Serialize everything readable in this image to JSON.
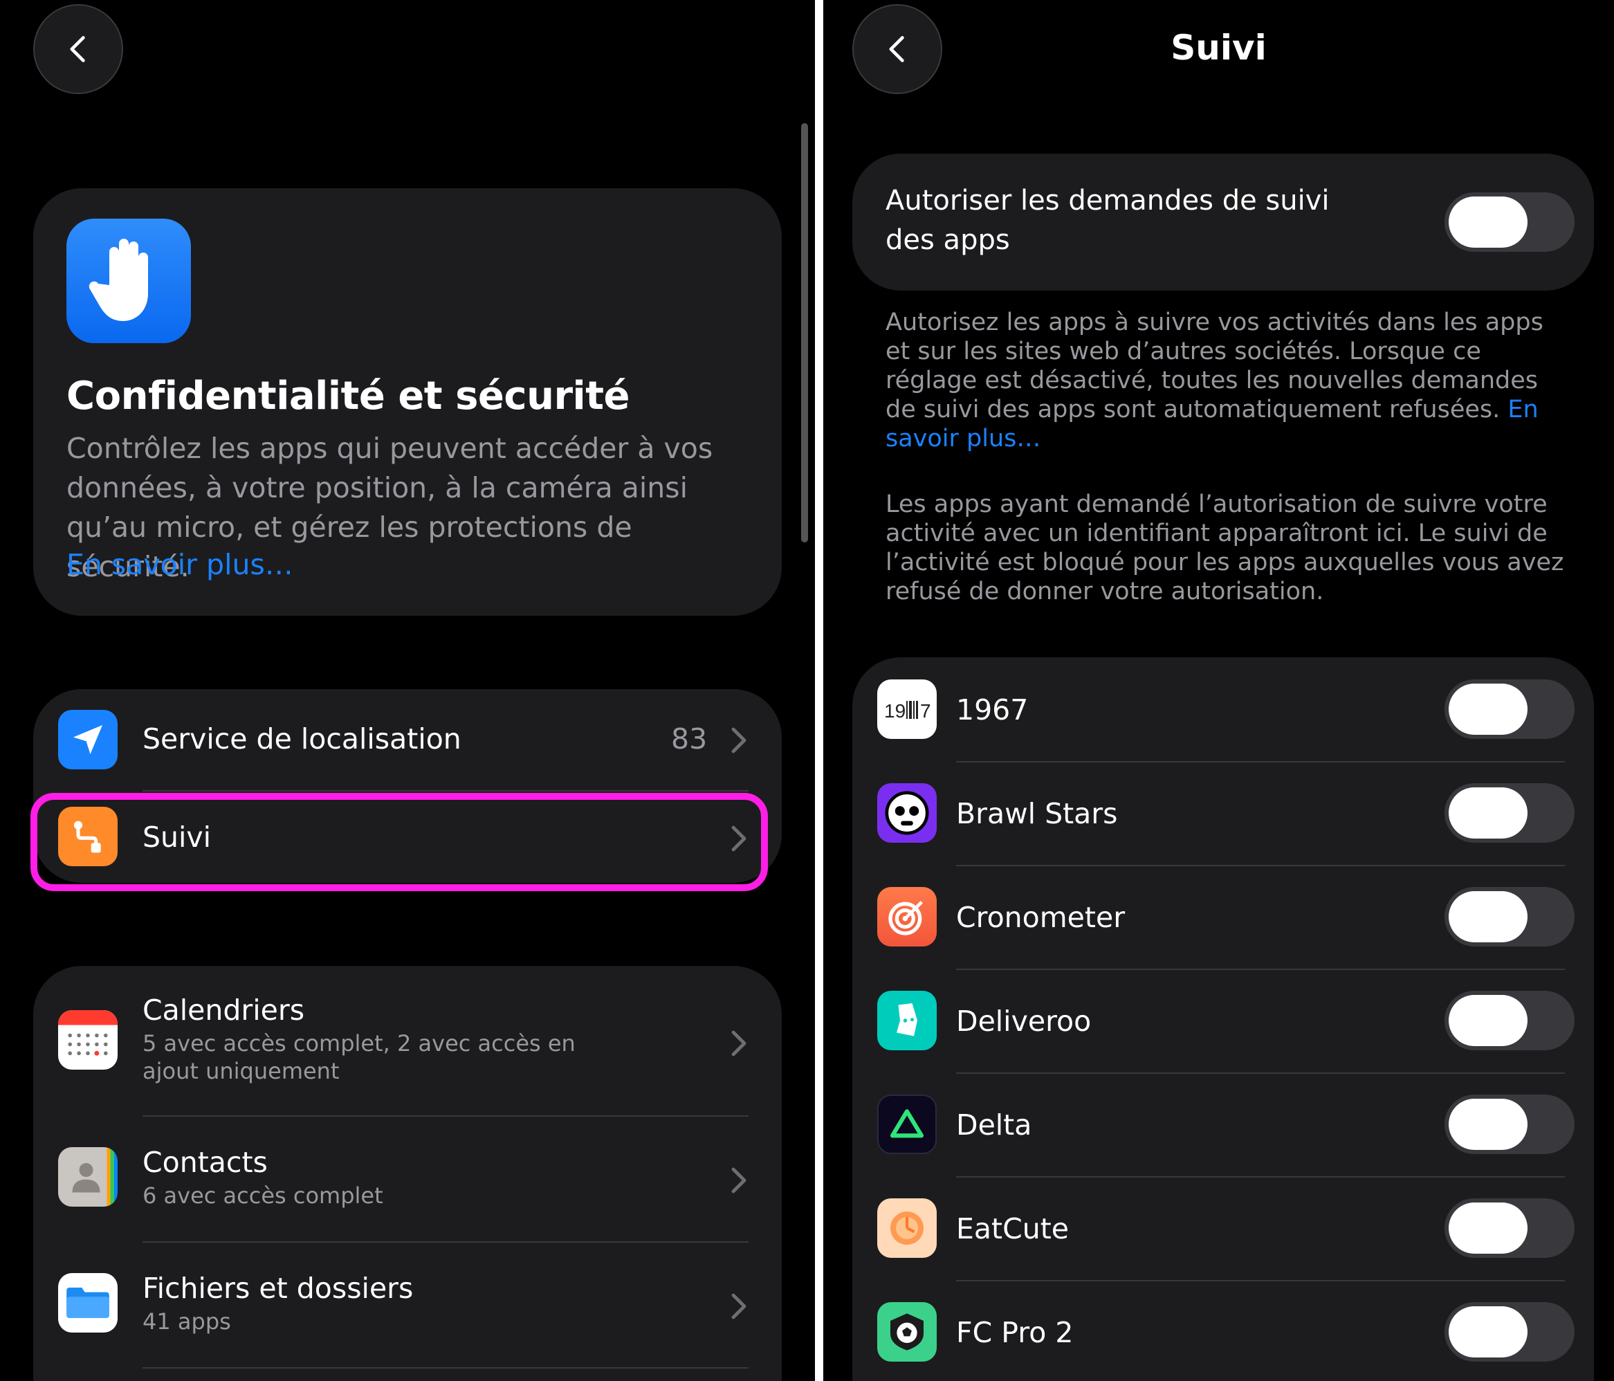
{
  "left": {
    "header": {
      "title": "Confidentialité et sécurité",
      "description": "Contrôlez les apps qui peuvent accéder à vos données, à votre position, à la caméra ainsi qu’au micro, et gérez les protections de sécurité.",
      "link": "En savoir plus…"
    },
    "group1": [
      {
        "title": "Service de localisation",
        "value": "83",
        "icon": "location-arrow-icon",
        "color": "#1a82ff"
      },
      {
        "title": "Suivi",
        "value": "",
        "icon": "tracking-icon",
        "color": "#ff8a2a"
      }
    ],
    "group2": [
      {
        "title": "Calendriers",
        "subtitle": "5 avec accès complet, 2 avec accès en ajout uniquement",
        "icon": "calendar-icon"
      },
      {
        "title": "Contacts",
        "subtitle": "6 avec accès complet",
        "icon": "contacts-icon"
      },
      {
        "title": "Fichiers et dossiers",
        "subtitle": "41 apps",
        "icon": "folder-icon"
      }
    ],
    "highlight_color": "#ff1ee6"
  },
  "right": {
    "nav_title": "Suivi",
    "allow": {
      "label": "Autoriser les demandes de suivi des apps",
      "on": false
    },
    "note1": "Autorisez les apps à suivre vos activités dans les apps et sur les sites web d’autres sociétés. Lorsque ce réglage est désactivé, toutes les nouvelles demandes de suivi des apps sont automatiquement refusées.",
    "note1_link": "En savoir plus…",
    "note2": "Les apps ayant demandé l’autorisation de suivre votre activité avec un identifiant apparaîtront ici. Le suivi de l’activité est bloqué pour les apps auxquelles vous avez refusé de donner votre autorisation.",
    "apps": [
      {
        "name": "1967",
        "icon": "1967-barcode-icon",
        "on": false
      },
      {
        "name": "Brawl Stars",
        "icon": "brawl-stars-skull-icon",
        "on": false
      },
      {
        "name": "Cronometer",
        "icon": "cronometer-icon",
        "on": false
      },
      {
        "name": "Deliveroo",
        "icon": "deliveroo-kangaroo-icon",
        "on": false
      },
      {
        "name": "Delta",
        "icon": "delta-triangle-icon",
        "on": false
      },
      {
        "name": "EatCute",
        "icon": "eatcute-icon",
        "on": false
      },
      {
        "name": "FC Pro 2",
        "icon": "fc-pro-soccer-ball-icon",
        "on": false
      }
    ],
    "icon_1967_text": "19 7"
  }
}
